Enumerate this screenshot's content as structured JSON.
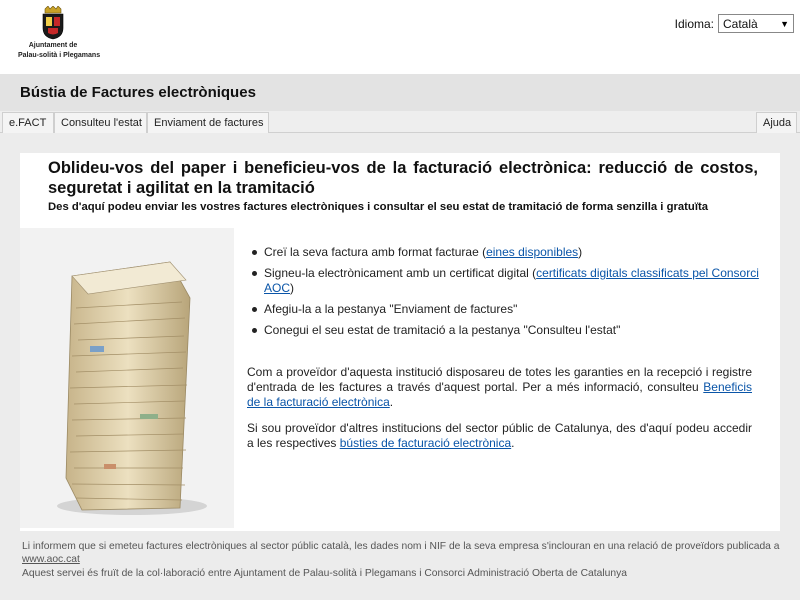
{
  "header": {
    "logo_line1": "Ajuntament de",
    "logo_line2": "Palau-solità i Plegamans",
    "language_label": "Idioma:",
    "language_selected": "Català"
  },
  "title": "Bústia de Factures electròniques",
  "tabs": {
    "efact": "e.FACT",
    "consulteu": "Consulteu l'estat",
    "enviament": "Enviament de factures",
    "ajuda": "Ajuda"
  },
  "content": {
    "headline": "Oblideu-vos del paper i beneficieu-vos de la facturació electrònica: reducció de costos, seguretat i agilitat en la tramitació",
    "subhead": "Des d'aquí podeu enviar les vostres factures electròniques i consultar el seu estat de tramitació de forma senzilla i gratuïta",
    "bullets": {
      "b1_pre": "Creï la seva factura amb format facturae (",
      "b1_link": "eines disponibles",
      "b1_post": ")",
      "b2_pre": "Signeu-la electrònicament amb un certificat digital (",
      "b2_link": "certificats digitals classificats pel Consorci AOC",
      "b2_post": ")",
      "b3": "Afegiu-la a la pestanya \"Enviament de factures\"",
      "b4": "Conegui el seu estat de tramitació a la pestanya \"Consulteu l'estat\""
    },
    "para1_pre": "Com a proveïdor d'aquesta institució disposareu de totes les garanties en la recepció i registre d'entrada de les factures a través d'aquest portal. Per a més informació, consulteu ",
    "para1_link": "Beneficis de la facturació electrònica",
    "para1_post": ".",
    "para2_pre": "Si sou proveïdor d'altres institucions del sector públic de Catalunya, des d'aquí podeu accedir a les respectives ",
    "para2_link": "bústies de facturació electrònica",
    "para2_post": "."
  },
  "footer": {
    "line1_pre": "Li informem que si emeteu factures electròniques al sector públic català, les dades nom i NIF de la seva empresa s'inclouran en una relació de proveïdors publicada a ",
    "line1_link": "www.aoc.cat",
    "line2": "Aquest servei és fruït de la col·laboració entre Ajuntament de Palau-solità i Plegamans i Consorci Administració Oberta de Catalunya"
  }
}
